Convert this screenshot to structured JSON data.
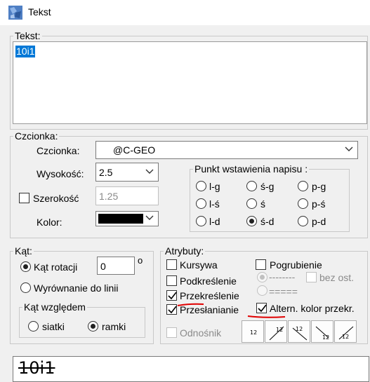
{
  "window": {
    "title": "Tekst"
  },
  "text_group": {
    "legend": "Tekst:",
    "value": "10i1"
  },
  "font_group": {
    "legend": "Czcionka:",
    "font_label": "Czcionka:",
    "font_value": "@C-GEO",
    "height_label": "Wysokość:",
    "height_value": "2.5",
    "width_label": "Szerokość",
    "width_value": "1.25",
    "width_checked": false,
    "color_label": "Kolor:",
    "color_value": "#000000"
  },
  "anchor_group": {
    "legend": "Punkt wstawienia napisu :",
    "options": [
      {
        "label": "l-g",
        "checked": false
      },
      {
        "label": "ś-g",
        "checked": false
      },
      {
        "label": "p-g",
        "checked": false
      },
      {
        "label": "l-ś",
        "checked": false
      },
      {
        "label": "ś",
        "checked": false
      },
      {
        "label": "p-ś",
        "checked": false
      },
      {
        "label": "l-d",
        "checked": false
      },
      {
        "label": "ś-d",
        "checked": true
      },
      {
        "label": "p-d",
        "checked": false
      }
    ]
  },
  "angle_group": {
    "legend": "Kąt:",
    "rotation_label": "Kąt rotacji",
    "rotation_value": "0",
    "degree_symbol": "o",
    "align_label": "Wyrównanie do linii",
    "relative": {
      "legend": "Kąt względem",
      "grid_label": "siatki",
      "frame_label": "ramki",
      "selected": "ramki"
    }
  },
  "attr_group": {
    "legend": "Atrybuty:",
    "italic": {
      "label": "Kursywa",
      "checked": false
    },
    "bold": {
      "label": "Pogrubienie",
      "checked": false
    },
    "underline": {
      "label": "Podkreślenie",
      "checked": false
    },
    "strike": {
      "label": "Przekreślenie",
      "checked": true
    },
    "overlap": {
      "label": "Przesłanianie",
      "checked": true
    },
    "alt_color": {
      "label": "Altern. kolor przekr.",
      "checked": true
    },
    "dash_text": "--------",
    "bez_ost": "bez ost.",
    "eq_text": "=====",
    "footnote": "Odnośnik",
    "orient_buttons": [
      {
        "name": "orient-horizontal-icon",
        "text": "12"
      },
      {
        "name": "orient-diagonal-up-icon",
        "text": "12"
      },
      {
        "name": "orient-diagonal-left-icon",
        "text": "12"
      },
      {
        "name": "orient-diagonal-down-icon",
        "text": "12"
      },
      {
        "name": "orient-diagonal-right-icon",
        "text": "12"
      }
    ]
  },
  "preview": {
    "text": "10i1"
  },
  "colors": {
    "selection": "#0078d7",
    "annotation": "#e00000"
  }
}
